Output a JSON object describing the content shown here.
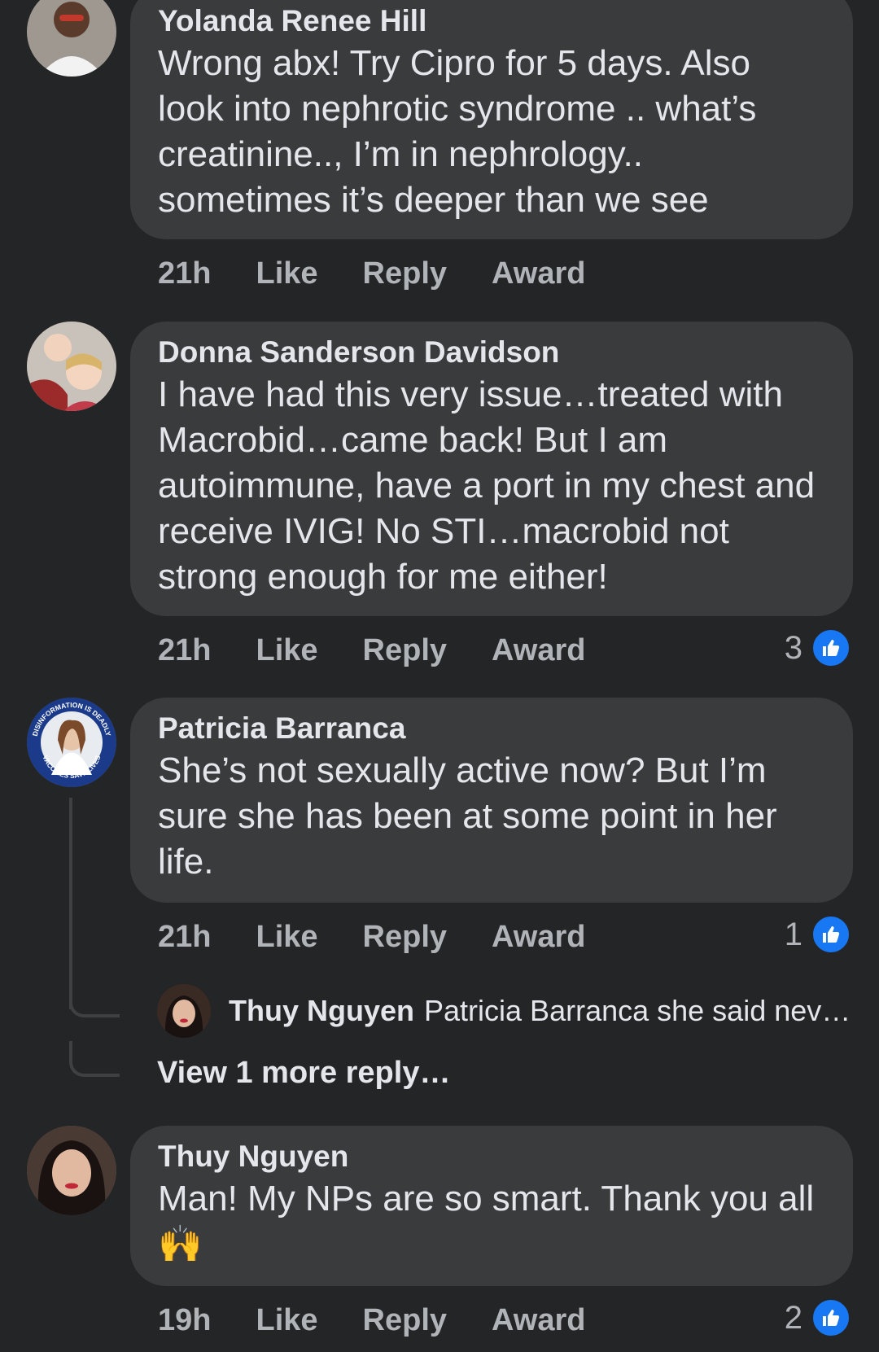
{
  "comments": [
    {
      "author": "Yolanda Renee Hill",
      "text": "Wrong abx! Try Cipro for 5 days. Also look into nephrotic syndrome .. what’s creatinine.., I’m in nephrology.. sometimes it’s deeper than we see",
      "time": "21h",
      "reactions": ""
    },
    {
      "author": "Donna Sanderson Davidson",
      "text": "I have had this very issue…treated with Macrobid…came back! But I am autoimmune, have a port in my chest and receive IVIG! No STI…macrobid not strong enough for me either!",
      "time": "21h",
      "reactions": "3"
    },
    {
      "author": "Patricia Barranca",
      "text": "She’s not sexually active now? But I’m sure she has been at some point in her life.",
      "time": "21h",
      "reactions": "1",
      "avatar_badge_top": "DISINFORMATION IS DEADLY",
      "avatar_badge_bottom": "VACCINES SAVE LIVES"
    },
    {
      "author": "Thuy Nguyen",
      "text": "Man! My NPs are so smart. Thank you all 🙌",
      "time": "19h",
      "reactions": "2"
    }
  ],
  "actions": {
    "like": "Like",
    "reply": "Reply",
    "award": "Award"
  },
  "reply_preview": {
    "author": "Thuy Nguyen",
    "text": "Patricia Barranca she said nev…"
  },
  "view_more": "View 1 more reply…",
  "colors": {
    "background": "#242526",
    "bubble": "#3a3b3c",
    "text": "#e4e6eb",
    "secondary": "#b0b3b8",
    "like_blue": "#1877f2"
  }
}
